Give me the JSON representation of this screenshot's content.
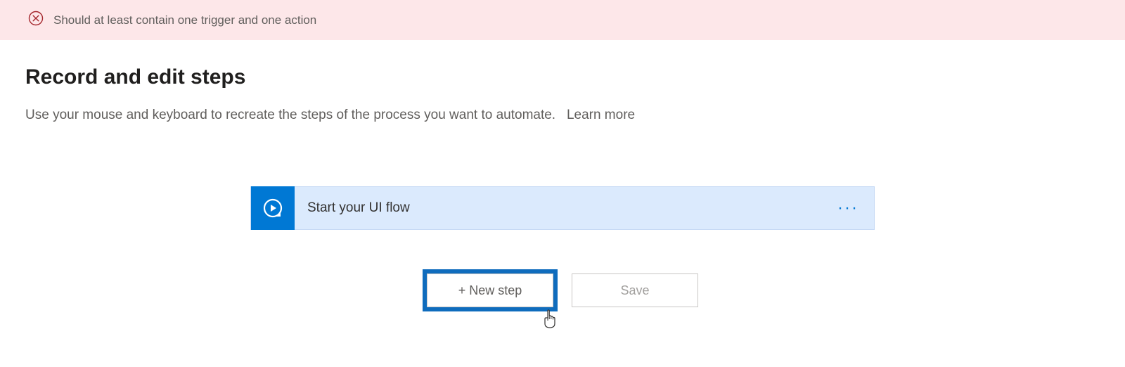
{
  "error": {
    "message": "Should at least contain one trigger and one action"
  },
  "header": {
    "title": "Record and edit steps",
    "description": "Use your mouse and keyboard to recreate the steps of the process you want to automate.",
    "learn_more": "Learn more"
  },
  "flow": {
    "start_label": "Start your UI flow",
    "more": "···"
  },
  "buttons": {
    "new_step": "+ New step",
    "save": "Save"
  }
}
